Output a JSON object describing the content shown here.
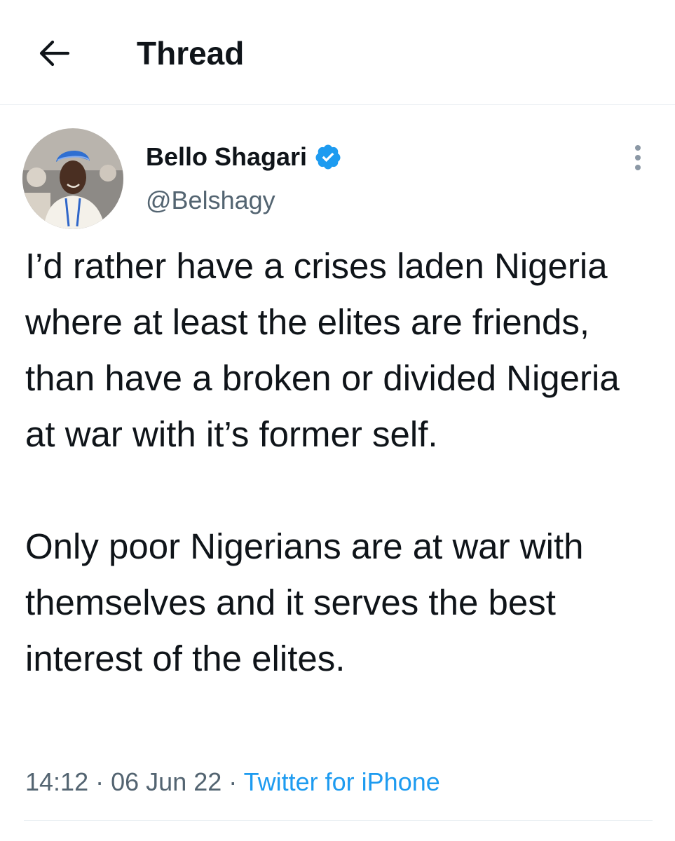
{
  "header": {
    "title": "Thread",
    "back_icon": "arrow-left-icon"
  },
  "tweet": {
    "author": {
      "display_name": "Bello Shagari",
      "handle": "@Belshagy",
      "verified": true,
      "verified_color": "#1d9bf0"
    },
    "paragraphs": [
      "I’d rather have a crises laden Nigeria where at least the elites are friends, than have a broken or divided Nigeria at war with it’s former self.",
      "Only poor Nigerians are at war with themselves and it serves the best interest of the elites."
    ],
    "time": "14:12",
    "date": "06 Jun 22",
    "source": "Twitter for iPhone",
    "separator": "·"
  },
  "colors": {
    "text": "#0f1419",
    "secondary": "#536471",
    "accent": "#1d9bf0",
    "divider": "#e6ecf0"
  }
}
